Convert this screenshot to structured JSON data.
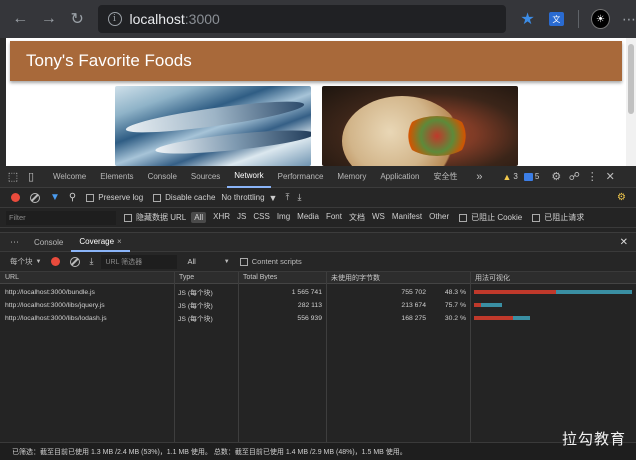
{
  "browser": {
    "url_host": "localhost",
    "url_port": ":3000",
    "avatar_letter": "☀"
  },
  "page": {
    "heading": "Tony's Favorite Foods"
  },
  "devtools": {
    "tabs": [
      "Welcome",
      "Elements",
      "Console",
      "Sources",
      "Network",
      "Performance",
      "Memory",
      "Application",
      "安全性"
    ],
    "active_tab": "Network",
    "warnings_count": "3",
    "issues_count": "5",
    "network_controls": {
      "preserve_log": "Preserve log",
      "disable_cache": "Disable cache",
      "throttling": "No throttling"
    },
    "filter": {
      "placeholder": "Filter",
      "hide_data_urls": "隐藏数据 URL",
      "types": [
        "All",
        "XHR",
        "JS",
        "CSS",
        "Img",
        "Media",
        "Font",
        "文档",
        "WS",
        "Manifest",
        "Other"
      ],
      "blocked_cookies": "已阻止 Cookie",
      "blocked_requests": "已阻止请求"
    },
    "drawer": {
      "tabs": [
        "Console",
        "Coverage"
      ],
      "active": "Coverage"
    },
    "coverage": {
      "granularity": "每个块",
      "url_filter_placeholder": "URL 筛选器",
      "type_filter": "All",
      "content_scripts": "Content scripts",
      "columns": [
        "URL",
        "Type",
        "Total Bytes",
        "未使用的字节数",
        "用法可视化"
      ],
      "rows": [
        {
          "url": "http://localhost:3000/bundle.js",
          "type": "JS (每个块)",
          "total_bytes": "1 565 741",
          "unused_bytes": "755 702",
          "unused_pct": "48.3 %",
          "used_fraction": 0.517,
          "width_fraction": 1.0
        },
        {
          "url": "http://localhost:3000/libs/jquery.js",
          "type": "JS (每个块)",
          "total_bytes": "282 113",
          "unused_bytes": "213 674",
          "unused_pct": "75.7 %",
          "used_fraction": 0.243,
          "width_fraction": 0.18
        },
        {
          "url": "http://localhost:3000/libs/lodash.js",
          "type": "JS (每个块)",
          "total_bytes": "556 939",
          "unused_bytes": "168 275",
          "unused_pct": "30.2 %",
          "used_fraction": 0.698,
          "width_fraction": 0.356
        }
      ],
      "footer": "已筛选：截至目前已使用 1.3 MB /2.4 MB (53%)，1.1 MB 使用。 总数：截至目前已使用 1.4 MB /2.9 MB (48%)，1.5 MB 使用。"
    }
  },
  "watermark": "拉勾教育",
  "colors": {
    "banner": "#a8693a",
    "used_bar": "#c0392b",
    "unused_bar": "#3a8fa3",
    "active_tab_underline": "#8ab4f8"
  }
}
